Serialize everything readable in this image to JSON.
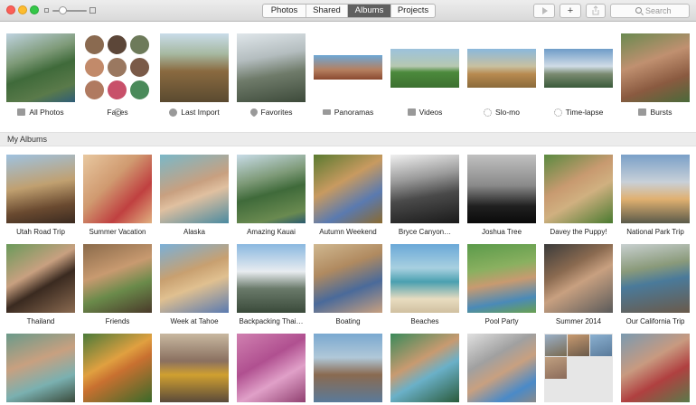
{
  "toolbar": {
    "tabs": [
      {
        "label": "Photos",
        "active": false
      },
      {
        "label": "Shared",
        "active": false
      },
      {
        "label": "Albums",
        "active": true
      },
      {
        "label": "Projects",
        "active": false
      }
    ],
    "play_icon": "play-icon",
    "add_label": "+",
    "share_icon": "share-icon",
    "search_placeholder": "Search"
  },
  "top_albums": [
    {
      "label": "All Photos",
      "icon": "folder-icon"
    },
    {
      "label": "Faces",
      "icon": "face-icon"
    },
    {
      "label": "Last Import",
      "icon": "clock-icon"
    },
    {
      "label": "Favorites",
      "icon": "heart-icon"
    },
    {
      "label": "Panoramas",
      "icon": "panorama-icon"
    },
    {
      "label": "Videos",
      "icon": "video-icon"
    },
    {
      "label": "Slo-mo",
      "icon": "slomo-icon"
    },
    {
      "label": "Time-lapse",
      "icon": "timelapse-icon"
    },
    {
      "label": "Bursts",
      "icon": "bursts-icon"
    }
  ],
  "section_title": "My Albums",
  "my_albums": [
    {
      "label": "Utah Road Trip"
    },
    {
      "label": "Summer Vacation"
    },
    {
      "label": "Alaska"
    },
    {
      "label": "Amazing Kauai"
    },
    {
      "label": "Autumn Weekend"
    },
    {
      "label": "Bryce Canyon…"
    },
    {
      "label": "Joshua Tree"
    },
    {
      "label": "Davey the Puppy!"
    },
    {
      "label": "National Park Trip"
    },
    {
      "label": "Thailand"
    },
    {
      "label": "Friends"
    },
    {
      "label": "Week at Tahoe"
    },
    {
      "label": "Backpacking Thai…"
    },
    {
      "label": "Boating"
    },
    {
      "label": "Beaches"
    },
    {
      "label": "Pool Party"
    },
    {
      "label": "Summer 2014"
    },
    {
      "label": "Our California Trip"
    },
    {
      "label": ""
    },
    {
      "label": ""
    },
    {
      "label": ""
    },
    {
      "label": ""
    },
    {
      "label": ""
    },
    {
      "label": ""
    },
    {
      "label": ""
    },
    {
      "label": ""
    },
    {
      "label": ""
    }
  ]
}
